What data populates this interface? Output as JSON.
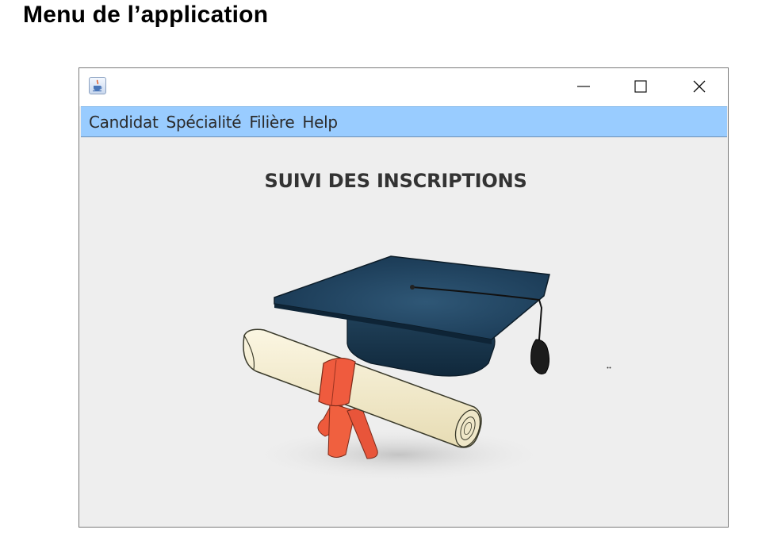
{
  "document": {
    "heading": "Menu de l’application"
  },
  "window": {
    "title": "",
    "app_icon": "java-coffee-icon",
    "controls": {
      "minimize_icon": "minimize-icon",
      "maximize_icon": "maximize-icon",
      "close_icon": "close-icon"
    },
    "menubar": {
      "background": "#99ccff",
      "items": [
        {
          "label": "Candidat"
        },
        {
          "label": "Spécialité"
        },
        {
          "label": "Filière"
        },
        {
          "label": "Help"
        }
      ]
    },
    "content": {
      "title": "SUIVI DES INSCRIPTIONS",
      "image": "graduation-cap-and-diploma-illustration"
    }
  }
}
